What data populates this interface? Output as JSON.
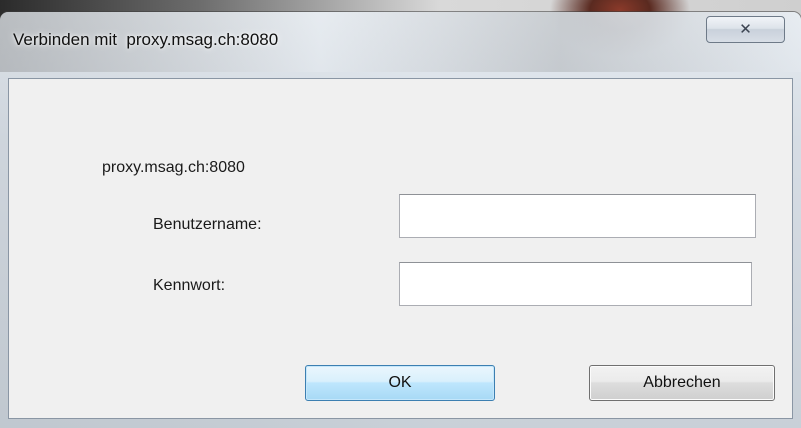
{
  "dialog": {
    "title": "Verbinden mit  proxy.msag.ch:8080",
    "close_icon": "close-icon",
    "host": "proxy.msag.ch:8080",
    "username_label": "Benutzername:",
    "username_value": "",
    "password_label": "Kennwort:",
    "password_value": "",
    "ok_label": "OK",
    "cancel_label": "Abbrechen"
  },
  "colors": {
    "ok_button_border": "#3c7fb1",
    "ok_button_fill": "#bee6fd",
    "client_background": "#f0f0f0"
  }
}
